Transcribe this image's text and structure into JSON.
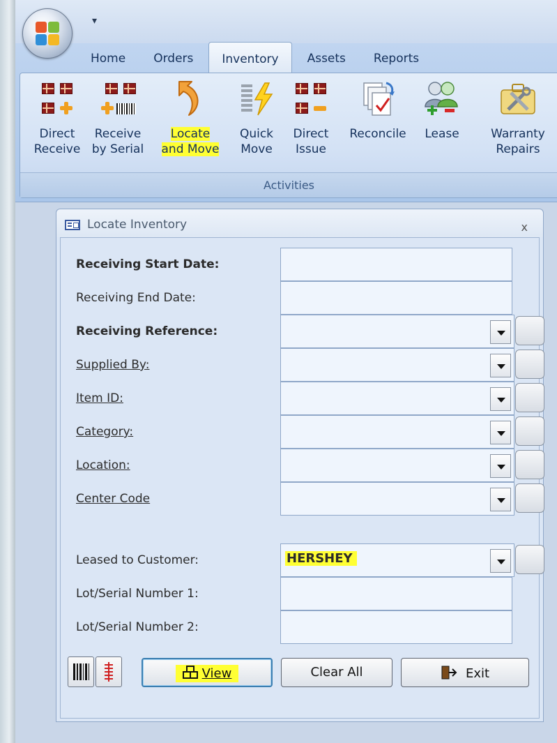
{
  "ribbon": {
    "tabs": [
      {
        "label": "Home",
        "active": false
      },
      {
        "label": "Orders",
        "active": false
      },
      {
        "label": "Inventory",
        "active": true
      },
      {
        "label": "Assets",
        "active": false
      },
      {
        "label": "Reports",
        "active": false
      }
    ],
    "group_label": "Activities",
    "buttons": [
      {
        "line1": "Direct",
        "line2": "Receive",
        "icon": "direct-receive-icon",
        "highlighted": false
      },
      {
        "line1": "Receive",
        "line2": "by Serial",
        "icon": "receive-by-serial-icon",
        "highlighted": false
      },
      {
        "line1": "Locate",
        "line2": "and Move",
        "icon": "locate-and-move-icon",
        "highlighted": true
      },
      {
        "line1": "Quick",
        "line2": "Move",
        "icon": "quick-move-icon",
        "highlighted": false
      },
      {
        "line1": "Direct",
        "line2": "Issue",
        "icon": "direct-issue-icon",
        "highlighted": false
      },
      {
        "line1": "Reconcile",
        "line2": "",
        "icon": "reconcile-icon",
        "highlighted": false
      },
      {
        "line1": "Lease",
        "line2": "",
        "icon": "lease-icon",
        "highlighted": false
      },
      {
        "line1": "Warranty",
        "line2": "Repairs",
        "icon": "warranty-repairs-icon",
        "highlighted": false
      }
    ],
    "quick_access_glyph": "₹"
  },
  "dialog": {
    "title": "Locate Inventory",
    "close": "x",
    "fields": [
      {
        "label": "Receiving Start Date:",
        "value": "",
        "style": "bold",
        "type": "text"
      },
      {
        "label": "Receiving End Date:",
        "value": "",
        "style": "normal",
        "type": "text"
      },
      {
        "label": "Receiving Reference:",
        "value": "",
        "style": "bold",
        "type": "combo"
      },
      {
        "label": "Supplied By:",
        "value": "",
        "style": "link",
        "type": "combo"
      },
      {
        "label": "Item ID:",
        "value": "",
        "style": "link",
        "type": "combo"
      },
      {
        "label": "Category:",
        "value": "",
        "style": "link",
        "type": "combo"
      },
      {
        "label": "Location:",
        "value": "",
        "style": "link",
        "type": "combo"
      },
      {
        "label": "Center Code",
        "value": "",
        "style": "link",
        "type": "combo"
      },
      {
        "label": "Leased to Customer:",
        "value": "HERSHEY",
        "style": "normal",
        "type": "combo"
      },
      {
        "label": "Lot/Serial Number 1:",
        "value": "",
        "style": "normal",
        "type": "text"
      },
      {
        "label": "Lot/Serial Number 2:",
        "value": "",
        "style": "normal",
        "type": "text"
      }
    ],
    "buttons": {
      "view": "View",
      "clear_all": "Clear All",
      "exit": "Exit"
    }
  },
  "colors": {
    "highlight": "#ffff33",
    "dialog_bg": "#dbe6f5",
    "ribbon_bg": "#d4e2f5"
  }
}
